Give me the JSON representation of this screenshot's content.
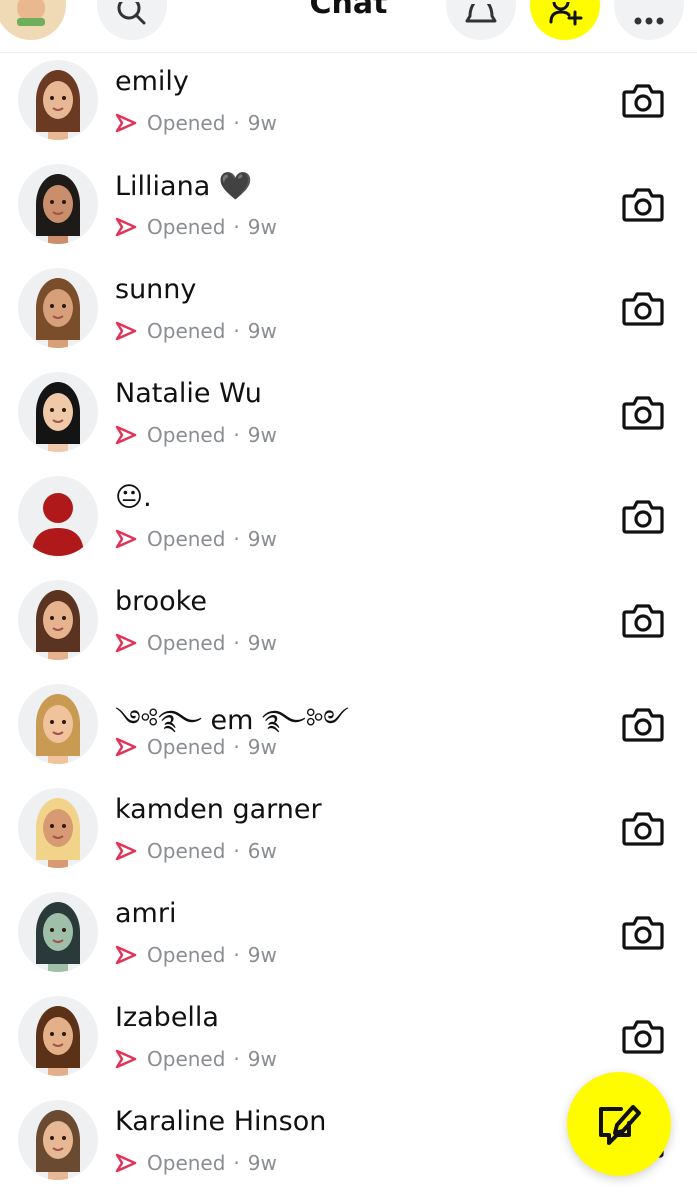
{
  "header": {
    "title": "Chat"
  },
  "chats": [
    {
      "name": "emily",
      "status": "Opened",
      "time": "9w",
      "skin": "#e8b894",
      "hair": "#6b3a22"
    },
    {
      "name": "Lilliana 🖤",
      "status": "Opened",
      "time": "9w",
      "skin": "#c98f6c",
      "hair": "#1e1a18"
    },
    {
      "name": "sunny",
      "status": "Opened",
      "time": "9w",
      "skin": "#d7a07a",
      "hair": "#7a4d2b"
    },
    {
      "name": "Natalie Wu",
      "status": "Opened",
      "time": "9w",
      "skin": "#f0c9a8",
      "hair": "#141414"
    },
    {
      "name": "😐.",
      "status": "Opened",
      "time": "9w",
      "skin": "#b01919",
      "hair": "#b01919"
    },
    {
      "name": "brooke",
      "status": "Opened",
      "time": "9w",
      "skin": "#e6b38e",
      "hair": "#5a3420"
    },
    {
      "name": "༺࿐ em ࿐༻",
      "status": "Opened",
      "time": "9w",
      "skin": "#f0c39c",
      "hair": "#c99a52"
    },
    {
      "name": "kamden garner",
      "status": "Opened",
      "time": "6w",
      "skin": "#d89a72",
      "hair": "#f2d38a"
    },
    {
      "name": "amri",
      "status": "Opened",
      "time": "9w",
      "skin": "#9fbfa8",
      "hair": "#2a3a3a"
    },
    {
      "name": "Izabella",
      "status": "Opened",
      "time": "9w",
      "skin": "#e3b08a",
      "hair": "#5b3218"
    },
    {
      "name": "Karaline Hinson",
      "status": "Opened",
      "time": "9w",
      "skin": "#e8b894",
      "hair": "#6a4a30"
    }
  ],
  "colors": {
    "accent_yellow": "#fffc00",
    "sent_arrow": "#e0355a",
    "secondary_text": "#8a8d91"
  },
  "icons": {
    "search": "search-icon",
    "bell": "bell-icon",
    "add_friend": "add-friend-icon",
    "more": "more-icon",
    "camera": "camera-icon",
    "new_chat": "new-chat-icon",
    "sent": "sent-arrow-icon"
  }
}
